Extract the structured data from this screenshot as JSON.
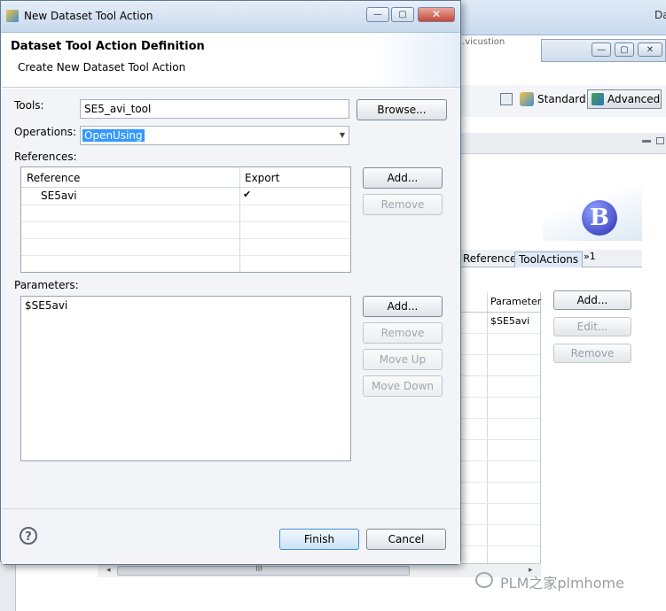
{
  "background_window": {
    "title_fragment": "Da",
    "sub_fragment": "..vicustion",
    "perspective": {
      "standard_label": "Standard",
      "advanced_label": "Advanced"
    },
    "tabs": [
      "References",
      "ToolActions",
      "»1"
    ],
    "param_grid": {
      "header": "Parameter",
      "value": "$SE5avi"
    },
    "buttons": {
      "add": "Add...",
      "edit": "Edit...",
      "remove": "Remove"
    },
    "scroll_label": "III",
    "logo_letter": "B"
  },
  "watermark": "PLM之家plmhome",
  "dialog": {
    "title": "New Dataset Tool Action",
    "titlebar_buttons": {
      "minimize": "—",
      "maximize": "▢",
      "close": "✕"
    },
    "header": {
      "title": "Dataset Tool Action Definition",
      "subtitle": "Create New Dataset Tool Action"
    },
    "tools": {
      "label": "Tools:",
      "value": "SE5_avi_tool",
      "browse": "Browse..."
    },
    "operations": {
      "label": "Operations:",
      "value": "OpenUsing"
    },
    "references": {
      "label": "References:",
      "columns": [
        "Reference",
        "Export"
      ],
      "rows": [
        {
          "reference": "SE5avi",
          "export": "✔"
        }
      ],
      "buttons": {
        "add": "Add...",
        "remove": "Remove"
      }
    },
    "parameters": {
      "label": "Parameters:",
      "items": [
        "$SE5avi"
      ],
      "buttons": {
        "add": "Add...",
        "remove": "Remove",
        "move_up": "Move Up",
        "move_down": "Move Down"
      }
    },
    "footer": {
      "help_icon": "?",
      "finish": "Finish",
      "cancel": "Cancel"
    }
  }
}
